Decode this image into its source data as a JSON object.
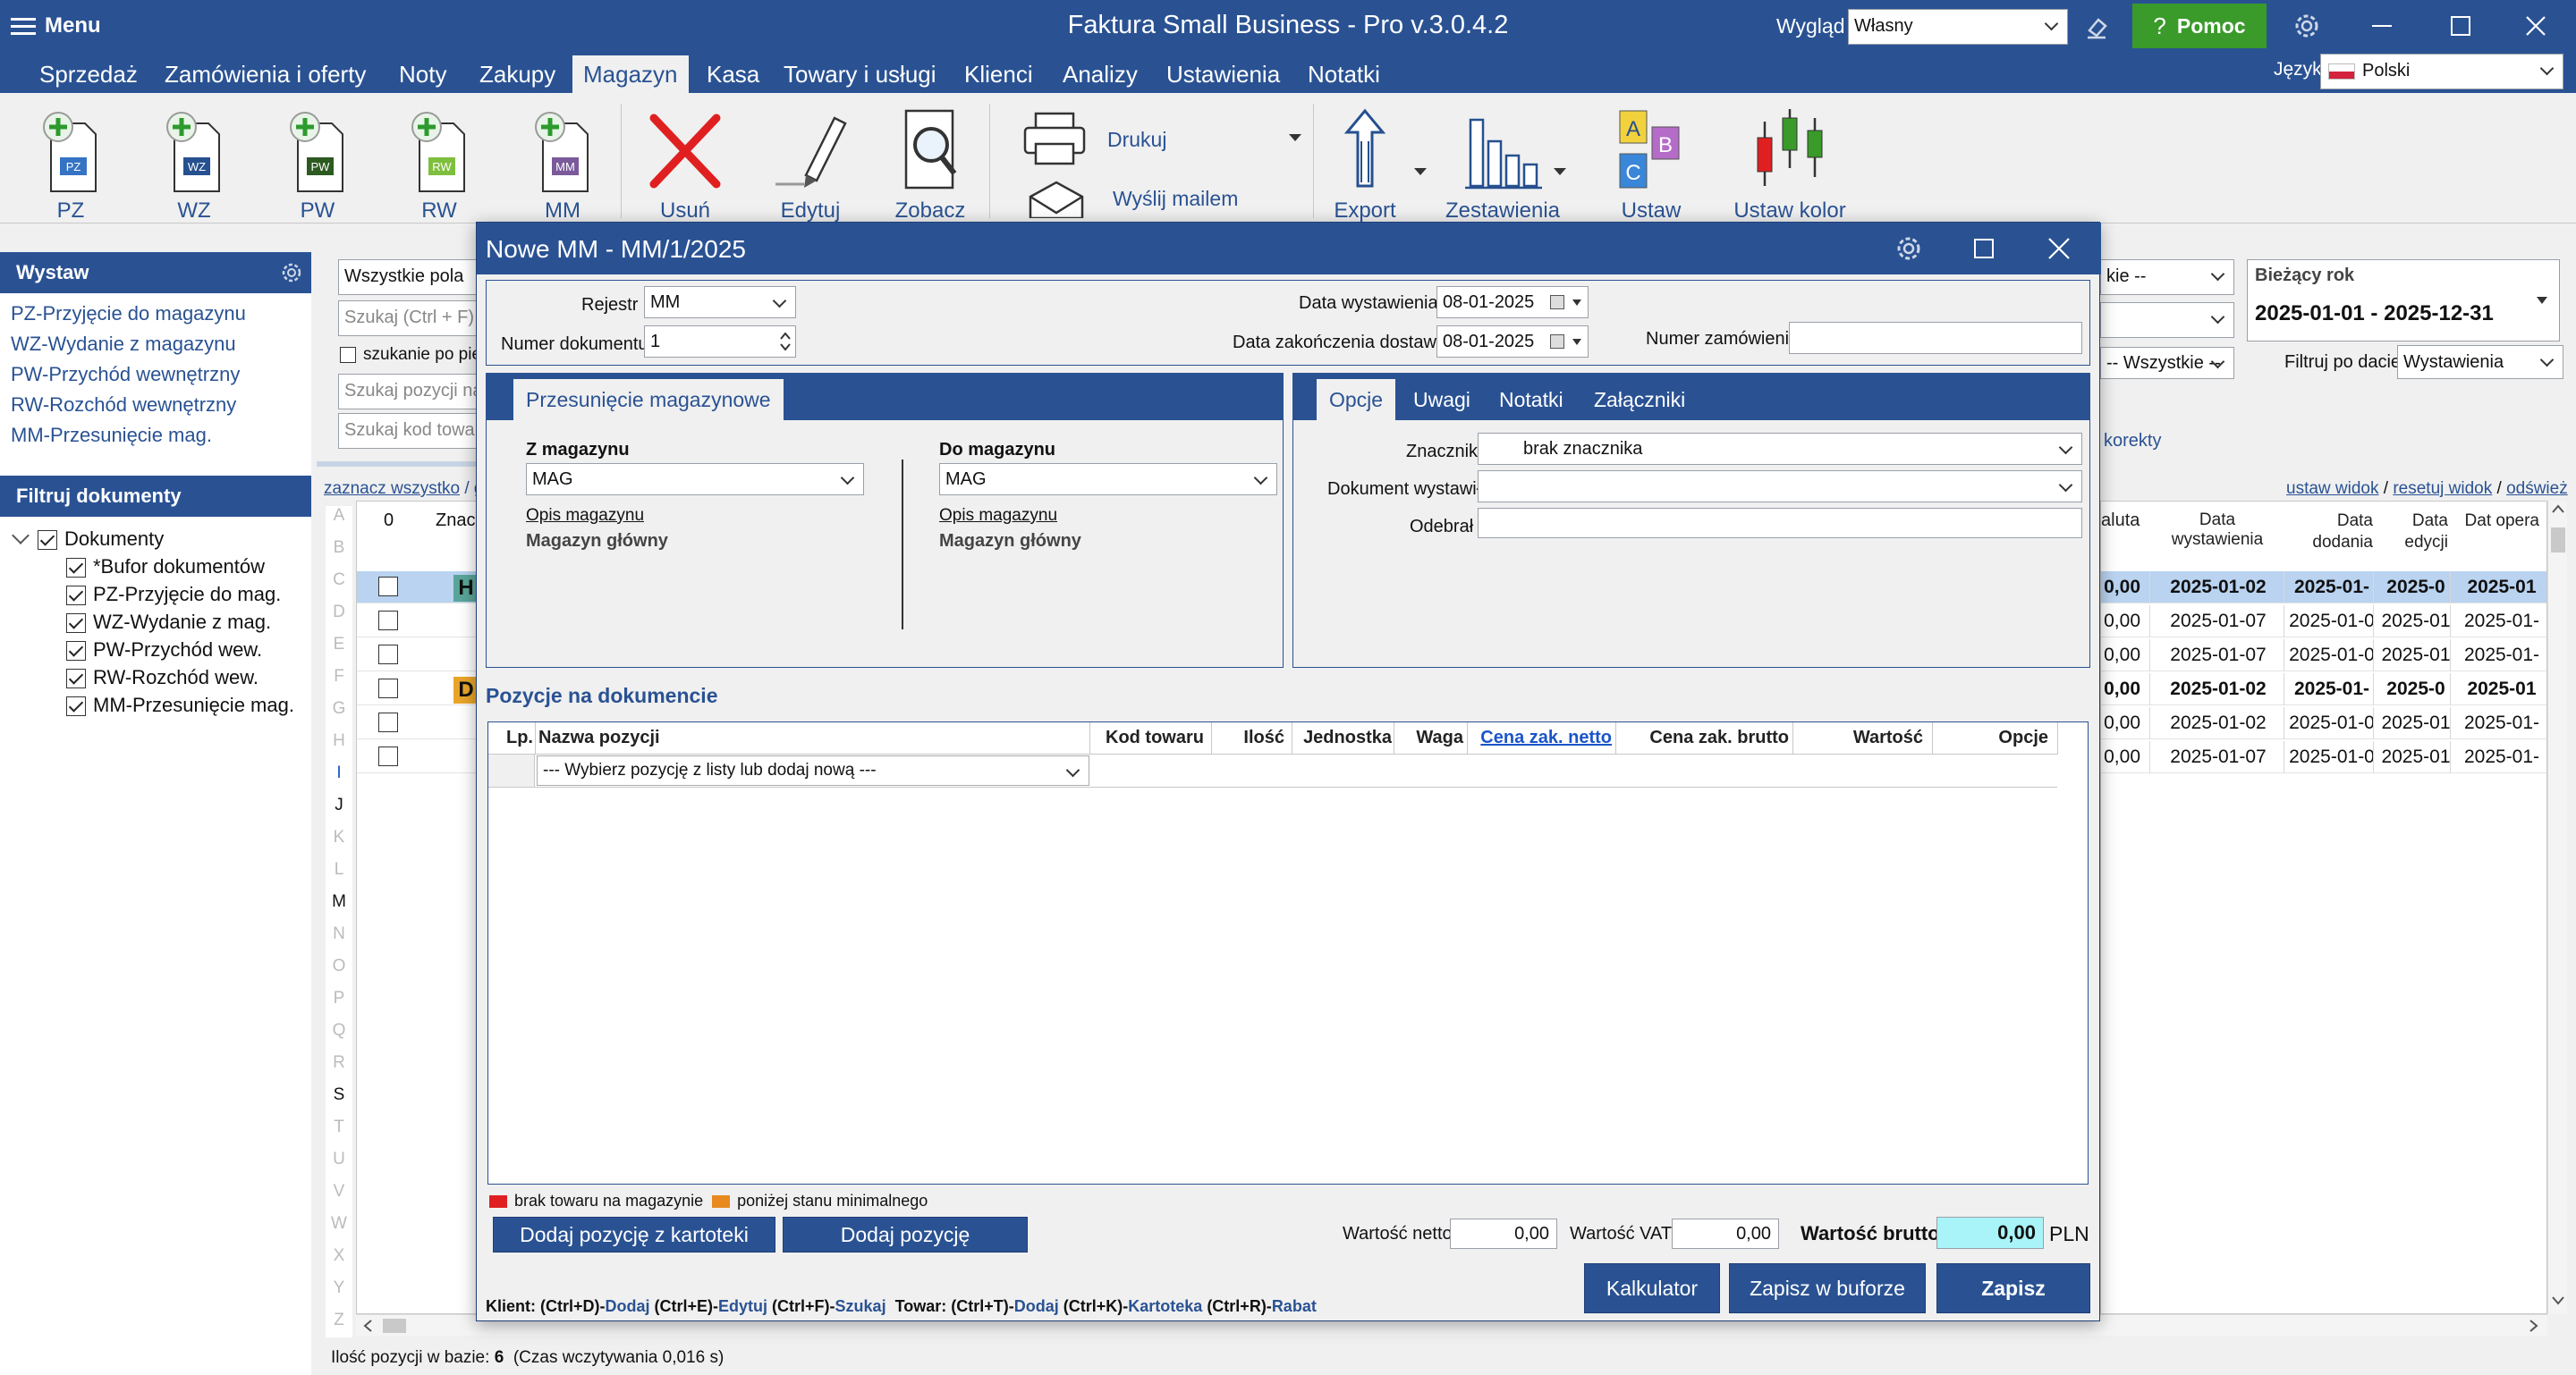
{
  "app": {
    "menu_label": "Menu",
    "title": "Faktura Small Business - Pro v.3.0.4.2",
    "wyglad_label": "Wygląd",
    "wyglad_value": "Własny",
    "help_label": "Pomoc",
    "jezyk_label": "Język",
    "jezyk_value": "Polski"
  },
  "menu": [
    "Sprzedaż",
    "Zamówienia i oferty",
    "Noty",
    "Zakupy",
    "Magazyn",
    "Kasa",
    "Towary i usługi",
    "Klienci",
    "Analizy",
    "Ustawienia",
    "Notatki"
  ],
  "ribbon": {
    "pz": "PZ",
    "wz": "WZ",
    "pw": "PW",
    "rw": "RW",
    "mm": "MM",
    "usun": "Usuń",
    "edytuj": "Edytuj",
    "zobacz": "Zobacz",
    "drukuj": "Drukuj",
    "wyslij": "Wyślij mailem",
    "export": "Export",
    "zestawienia": "Zestawienia",
    "ustaw": "Ustaw",
    "ustaw_kolor": "Ustaw kolor"
  },
  "sidebar": {
    "wystaw_title": "Wystaw",
    "wystaw_items": [
      "PZ-Przyjęcie do magazynu",
      "WZ-Wydanie z magazynu",
      "PW-Przychód wewnętrzny",
      "RW-Rozchód wewnętrzny",
      "MM-Przesunięcie mag."
    ],
    "filter_title": "Filtruj dokumenty",
    "tree_root": "Dokumenty",
    "tree_items": [
      "*Bufor dokumentów",
      "PZ-Przyjęcie do mag.",
      "WZ-Wydanie z mag.",
      "PW-Przychód wew.",
      "RW-Rozchód wew.",
      "MM-Przesunięcie mag."
    ]
  },
  "search": {
    "all_fields": "Wszystkie pola",
    "search_ph": "Szukaj (Ctrl + F)",
    "search_mode": "szukanie po pie",
    "pos_ph": "Szukaj pozycji na",
    "code_ph": "Szukaj kod towar"
  },
  "grid_left": {
    "select_all": "zaznacz wszystko",
    "slash_g": "/ g",
    "col0": "0",
    "col_znacznik": "Znacz",
    "alphabet": [
      "A",
      "B",
      "C",
      "D",
      "E",
      "F",
      "G",
      "H",
      "I",
      "J",
      "K",
      "L",
      "M",
      "N",
      "O",
      "P",
      "Q",
      "R",
      "S",
      "T",
      "U",
      "V",
      "W",
      "X",
      "Y",
      "Z"
    ],
    "tag_h": "H",
    "tag_d": "D"
  },
  "right": {
    "all1": "kie --",
    "current_year_label": "Bieżący rok",
    "date_range": "2025-01-01 - 2025-12-31",
    "all3": "-- Wszystkie --",
    "filter_label": "Filtruj po dacie",
    "filter_value": "Wystawienia",
    "korekty": "korekty",
    "view_links": [
      "ustaw widok",
      "resetuj widok",
      "odśwież"
    ],
    "headers": [
      "aluta",
      "Data wystawienia",
      "Data dodania",
      "Data edycji",
      "Dat opera"
    ],
    "rows": [
      [
        "0,00",
        "2025-01-02",
        "2025-01-",
        "2025-0",
        "2025-01"
      ],
      [
        "0,00",
        "2025-01-07",
        "2025-01-0",
        "2025-01",
        "2025-01-"
      ],
      [
        "0,00",
        "2025-01-07",
        "2025-01-0",
        "2025-01",
        "2025-01-"
      ],
      [
        "0,00",
        "2025-01-02",
        "2025-01-",
        "2025-0",
        "2025-01"
      ],
      [
        "0,00",
        "2025-01-02",
        "2025-01-0",
        "2025-01",
        "2025-01-"
      ],
      [
        "0,00",
        "2025-01-07",
        "2025-01-0",
        "2025-01",
        "2025-01-"
      ]
    ]
  },
  "status": {
    "label": "Ilość pozycji w bazie:",
    "count": "6",
    "time": "(Czas wczytywania 0,016 s)"
  },
  "dialog": {
    "title": "Nowe MM - MM/1/2025",
    "rejestr_label": "Rejestr",
    "rejestr_value": "MM",
    "numer_label": "Numer dokumentu",
    "numer_value": "1",
    "data_wyst_label": "Data wystawienia",
    "data_wyst_value": "08-01-2025",
    "data_zak_label": "Data zakończenia dostawy",
    "data_zak_value": "08-01-2025",
    "numer_zam_label": "Numer zamówienia",
    "numer_zam_value": "",
    "transfer_tab": "Przesunięcie magazynowe",
    "z_mag_label": "Z magazynu",
    "z_mag_value": "MAG",
    "do_mag_label": "Do magazynu",
    "do_mag_value": "MAG",
    "opis_link": "Opis magazynu",
    "mag_name": "Magazyn główny",
    "tabs": [
      "Opcje",
      "Uwagi",
      "Notatki",
      "Załączniki"
    ],
    "znacznik_label": "Znacznik",
    "znacznik_value": "brak znacznika",
    "dok_wyst_label": "Dokument wystawił",
    "dok_wyst_value": "",
    "odebral_label": "Odebrał",
    "odebral_value": "",
    "positions_title": "Pozycje na dokumencie",
    "pos_headers": {
      "lp": "Lp.",
      "nazwa": "Nazwa pozycji",
      "kod": "Kod towaru",
      "ilosc": "Ilość",
      "jednostka": "Jednostka",
      "waga": "Waga",
      "cena_netto": "Cena zak. netto",
      "cena_brutto": "Cena zak. brutto",
      "wartosc": "Wartość",
      "opcje": "Opcje"
    },
    "pos_select": "--- Wybierz pozycję z listy lub dodaj nową ---",
    "legend_red": "brak towaru na magazynie",
    "legend_orange": "poniżej stanu minimalnego",
    "add_from_catalog": "Dodaj pozycję z kartoteki",
    "add_position": "Dodaj pozycję",
    "netto_label": "Wartość netto",
    "netto_value": "0,00",
    "vat_label": "Wartość VAT",
    "vat_value": "0,00",
    "brutto_label": "Wartość brutto",
    "brutto_value": "0,00",
    "currency": "PLN",
    "calc_btn": "Kalkulator",
    "save_buffer_btn": "Zapisz w buforze",
    "save_btn": "Zapisz",
    "shortcuts": {
      "klient": "Klient:",
      "k1": "(Ctrl+D)-",
      "dodaj": "Dodaj",
      "k2": " (Ctrl+E)-",
      "edytuj": "Edytuj",
      "k3": " (Ctrl+F)-",
      "szukaj": "Szukaj",
      "towar": "Towar:",
      "t1": " (Ctrl+T)-",
      "tdodaj": "Dodaj",
      "t2": " (Ctrl+K)-",
      "kartoteka": "Kartoteka",
      "t3": " (Ctrl+R)-",
      "rabat": "Rabat"
    }
  },
  "colors": {
    "brand": "#2a5293",
    "help_green": "#3a9a2a",
    "highlight": "#b9d3f0",
    "brutto_bg": "#a8f4f8",
    "legend_red": "#e02020",
    "legend_orange": "#e88a20"
  }
}
